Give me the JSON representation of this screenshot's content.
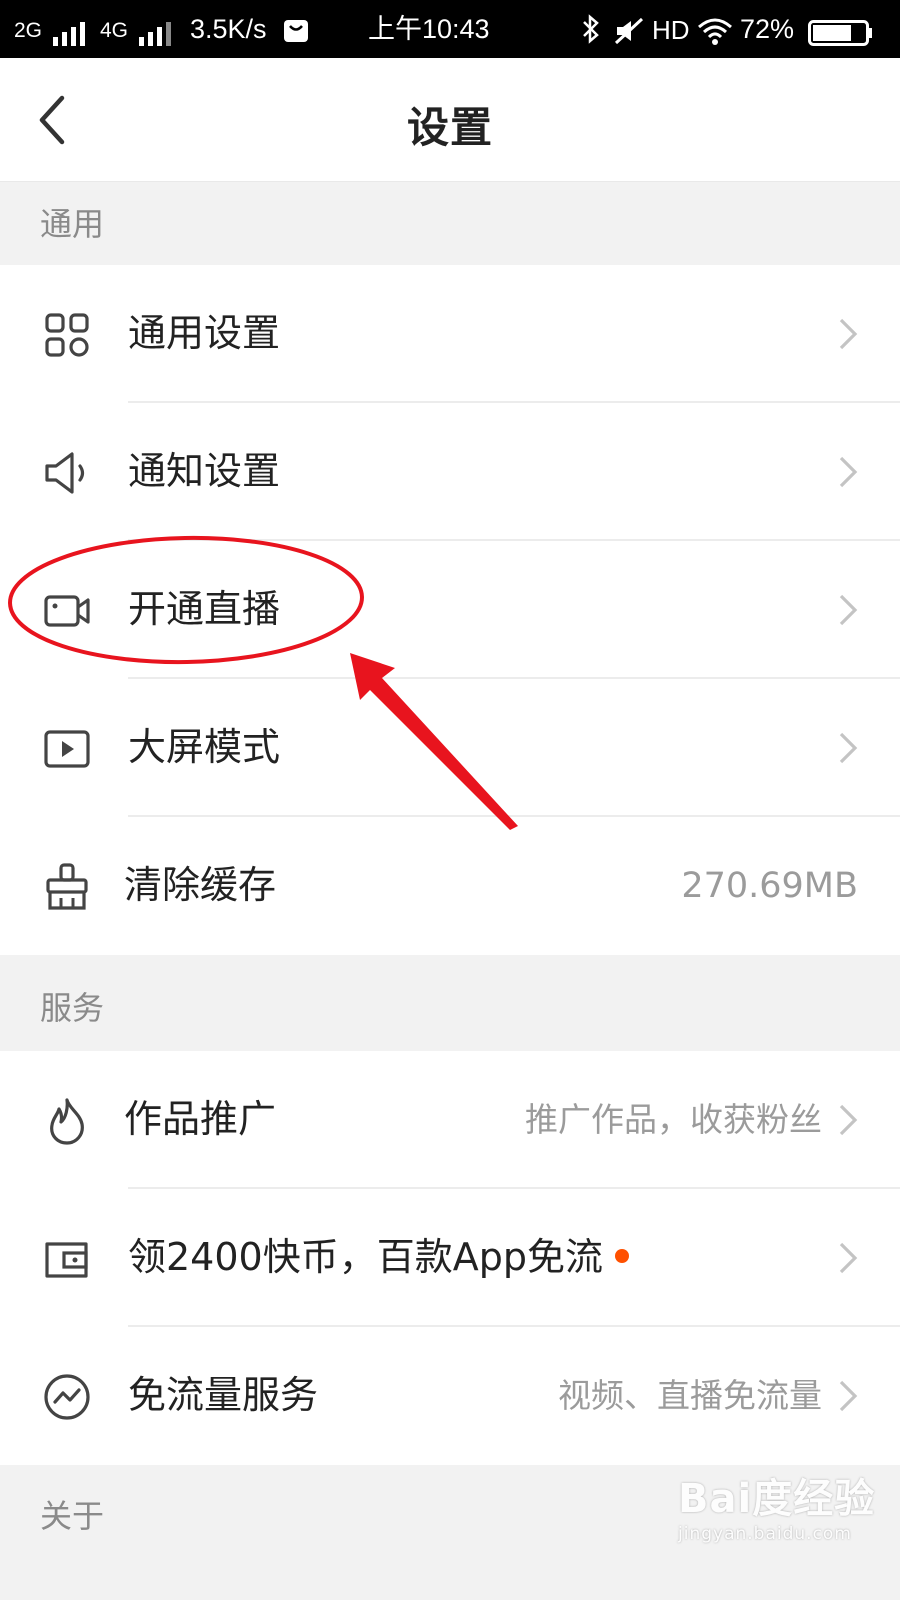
{
  "status_bar": {
    "net1": "2G",
    "net2": "4G",
    "speed": "3.5K/s",
    "time": "上午10:43",
    "hd": "HD",
    "battery": "72%"
  },
  "header": {
    "title": "设置"
  },
  "sections": {
    "general": "通用",
    "service": "服务",
    "about": "关于"
  },
  "general_items": {
    "general_settings": "通用设置",
    "notification_settings": "通知设置",
    "open_live": "开通直播",
    "big_screen": "大屏模式",
    "clear_cache": "清除缓存",
    "cache_size": "270.69MB"
  },
  "service_items": {
    "promotion": "作品推广",
    "promotion_desc": "推广作品，收获粉丝",
    "coins": "领2400快币，百款App免流",
    "free_data": "免流量服务",
    "free_data_desc": "视频、直播免流量"
  },
  "watermark": {
    "logo": "Bai度经验",
    "url": "jingyan.baidu.com"
  },
  "colors": {
    "annotation_red": "#e8141e",
    "badge_dot": "#ff5000",
    "section_bg": "#f2f2f2"
  }
}
